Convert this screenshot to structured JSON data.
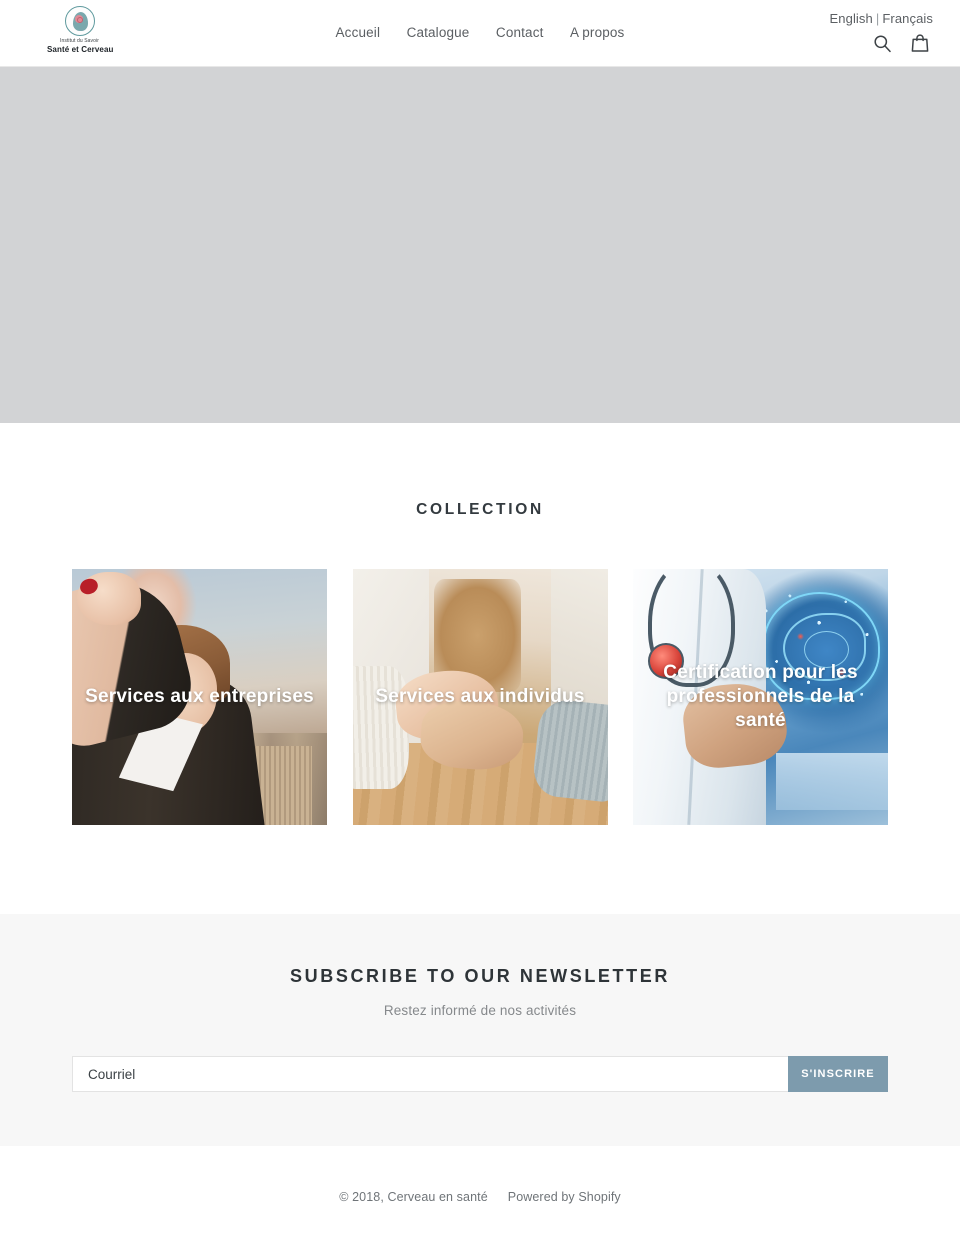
{
  "header": {
    "logo": {
      "line1": "Institut du Savoir",
      "line2": "Santé et Cerveau",
      "icon": "brain-head-circle-icon"
    },
    "nav": [
      {
        "label": "Accueil"
      },
      {
        "label": "Catalogue"
      },
      {
        "label": "Contact"
      },
      {
        "label": "A propos"
      }
    ],
    "languages": {
      "english": "English",
      "separator": "|",
      "francais": "Français"
    },
    "icons": {
      "search": "search-icon",
      "cart": "shopping-bag-icon"
    }
  },
  "hero": {
    "placeholder_color": "#d2d3d5"
  },
  "collection": {
    "title": "COLLECTION",
    "cards": [
      {
        "label": "Services aux entreprises",
        "image": "businesswoman-raised-fist-city-skyline"
      },
      {
        "label": "Services aux individus",
        "image": "clasped-hands-on-wooden-table"
      },
      {
        "label": "Certification pour les professionnels de la santé",
        "image": "doctor-with-holographic-brain"
      }
    ]
  },
  "newsletter": {
    "title": "SUBSCRIBE TO OUR NEWSLETTER",
    "subtitle": "Restez informé de nos activités",
    "input_placeholder": "Courriel",
    "input_value": "",
    "button_label": "S'INSCRIRE",
    "button_color": "#7d9bad"
  },
  "footer": {
    "copyright": "© 2018, Cerveau en santé",
    "powered_by": "Powered by Shopify"
  }
}
